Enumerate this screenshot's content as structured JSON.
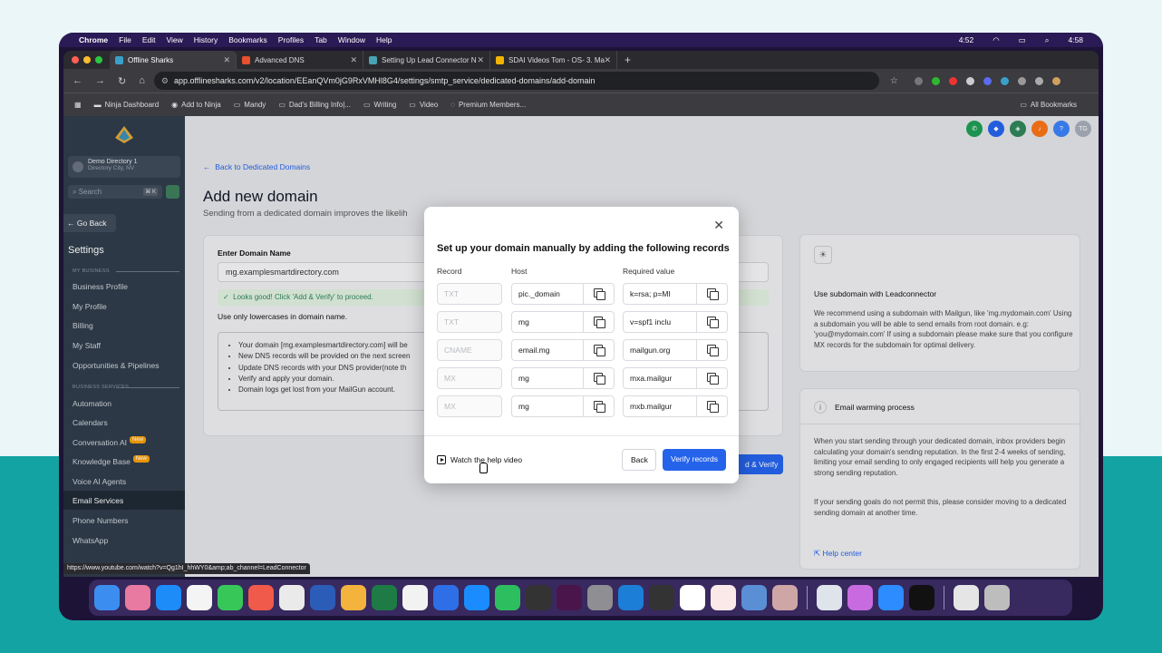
{
  "menubar": {
    "app": "Chrome",
    "items": [
      "File",
      "Edit",
      "View",
      "History",
      "Bookmarks",
      "Profiles",
      "Tab",
      "Window",
      "Help"
    ],
    "status": [
      "4:52"
    ],
    "clock": "4:58"
  },
  "browser": {
    "tabs": [
      {
        "label": "Offline Sharks",
        "color": "#3aa0c9"
      },
      {
        "label": "Advanced DNS",
        "color": "#e9502d"
      },
      {
        "label": "Setting Up Lead Connector N",
        "color": "#4aa3b5"
      },
      {
        "label": "SDAI Videos Tom - OS- 3. Ma",
        "color": "#f2b400"
      }
    ],
    "url": "app.offlinesharks.com/v2/location/EEanQVm0jG9RxVMHl8G4/settings/smtp_service/dedicated-domains/add-domain",
    "bookmarks": [
      "Ninja Dashboard",
      "Add to Ninja",
      "Mandy",
      "Dad's Billing Info|...",
      "Writing",
      "Video",
      "Premium Members..."
    ],
    "all_bookmarks": "All Bookmarks",
    "status_url": "https://www.youtube.com/watch?v=Qg1hI_hhWY0&amp;ab_channel=LeadConnector"
  },
  "sidebar": {
    "location_name": "Demo Directory 1",
    "location_sub": "Directory City, NV",
    "search_placeholder": "Search",
    "search_shortcut": "⌘ K",
    "go_back": "Go Back",
    "settings_title": "Settings",
    "section_business": "MY BUSINESS",
    "section_business_services": "BUSINESS SERVICES",
    "items": [
      {
        "label": "Business Profile"
      },
      {
        "label": "My Profile"
      },
      {
        "label": "Billing"
      },
      {
        "label": "My Staff"
      },
      {
        "label": "Opportunities & Pipelines"
      },
      {
        "label": "Automation"
      },
      {
        "label": "Calendars"
      },
      {
        "label": "Conversation AI",
        "badge": "New"
      },
      {
        "label": "Knowledge Base",
        "badge": "New"
      },
      {
        "label": "Voice AI Agents"
      },
      {
        "label": "Email Services"
      },
      {
        "label": "Phone Numbers"
      },
      {
        "label": "WhatsApp"
      }
    ]
  },
  "header": {
    "avatar_initials": "TG",
    "help": "?"
  },
  "page": {
    "back_link": "Back to Dedicated Domains",
    "title": "Add new domain",
    "subtitle": "Sending from a dedicated domain improves the likelih",
    "domain_label": "Enter Domain Name",
    "domain_value": "mg.examplesmartdirectory.com",
    "success": "Looks good! Click 'Add & Verify' to proceed.",
    "hint": "Use only lowercases in domain name.",
    "steps": [
      "Your domain [mg.examplesmartdirectory.com] will be",
      "New DNS records will be provided on the next screen",
      "Update DNS records with your DNS provider(note th",
      "Verify and apply your domain.",
      "Domain logs get lost from your MailGun account."
    ],
    "add_verify": "d & Verify"
  },
  "right_panel": {
    "card1_title": "Use subdomain with Leadconnector",
    "card1_body": "We recommend using a subdomain with Mailgun, like 'mg.mydomain.com' Using a subdomain you will be able to send emails from root domain. e.g: 'you@mydomain.com' If using a subdomain please make sure that you configure MX records for the subdomain for optimal delivery.",
    "card2_title": "Email warming process",
    "card2_body1": "When you start sending through your dedicated domain, inbox providers begin calculating your domain's sending reputation. In the first 2-4 weeks of sending, limiting your email sending to only engaged recipients will help you generate a strong sending reputation.",
    "card2_body2": "If your sending goals do not permit this, please consider moving to a dedicated sending domain at another time.",
    "help_center": "Help center"
  },
  "modal": {
    "title": "Set up your domain manually by adding the following records",
    "col_record": "Record",
    "col_host": "Host",
    "col_value": "Required value",
    "rows": [
      {
        "record": "TXT",
        "host": "pic._domain",
        "value": "k=rsa; p=MI"
      },
      {
        "record": "TXT",
        "host": "mg",
        "value": "v=spf1 inclu"
      },
      {
        "record": "CNAME",
        "host": "email.mg",
        "value": "mailgun.org"
      },
      {
        "record": "MX",
        "host": "mg",
        "value": "mxa.mailgur"
      },
      {
        "record": "MX",
        "host": "mg",
        "value": "mxb.mailgur"
      }
    ],
    "watch_video": "Watch the help video",
    "back": "Back",
    "verify": "Verify records"
  }
}
